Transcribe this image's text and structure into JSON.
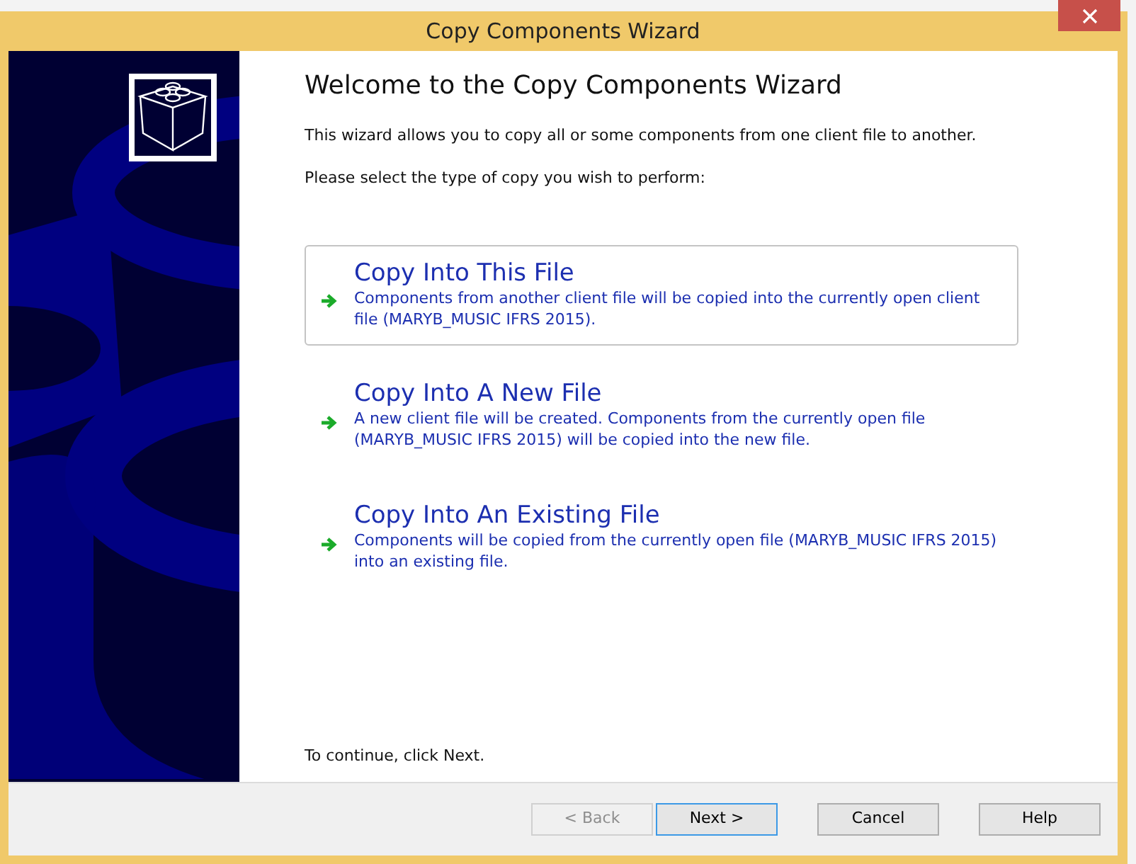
{
  "window": {
    "title": "Copy Components Wizard"
  },
  "heading": "Welcome to the Copy Components Wizard",
  "intro": "This wizard allows you to copy all or some components from one client file to another.",
  "prompt": "Please select the type of copy you wish to perform:",
  "options": [
    {
      "title": "Copy Into This File",
      "description": "Components from another client file will be copied into the currently open client file (MARYB_MUSIC IFRS 2015).",
      "selected": true
    },
    {
      "title": "Copy Into A New File",
      "description": "A new client file will be created. Components from the currently open file (MARYB_MUSIC IFRS 2015) will be copied into the new file.",
      "selected": false
    },
    {
      "title": "Copy Into An Existing File",
      "description": "Components will be copied from the currently open file (MARYB_MUSIC IFRS 2015) into an existing file.",
      "selected": false
    }
  ],
  "footer_note": "To continue, click Next.",
  "buttons": [
    {
      "label": "< Back",
      "disabled": true,
      "default": false
    },
    {
      "label": "Next >",
      "disabled": false,
      "default": true
    },
    {
      "label": "Cancel",
      "disabled": false,
      "default": false
    },
    {
      "label": "Help",
      "disabled": false,
      "default": false
    }
  ]
}
